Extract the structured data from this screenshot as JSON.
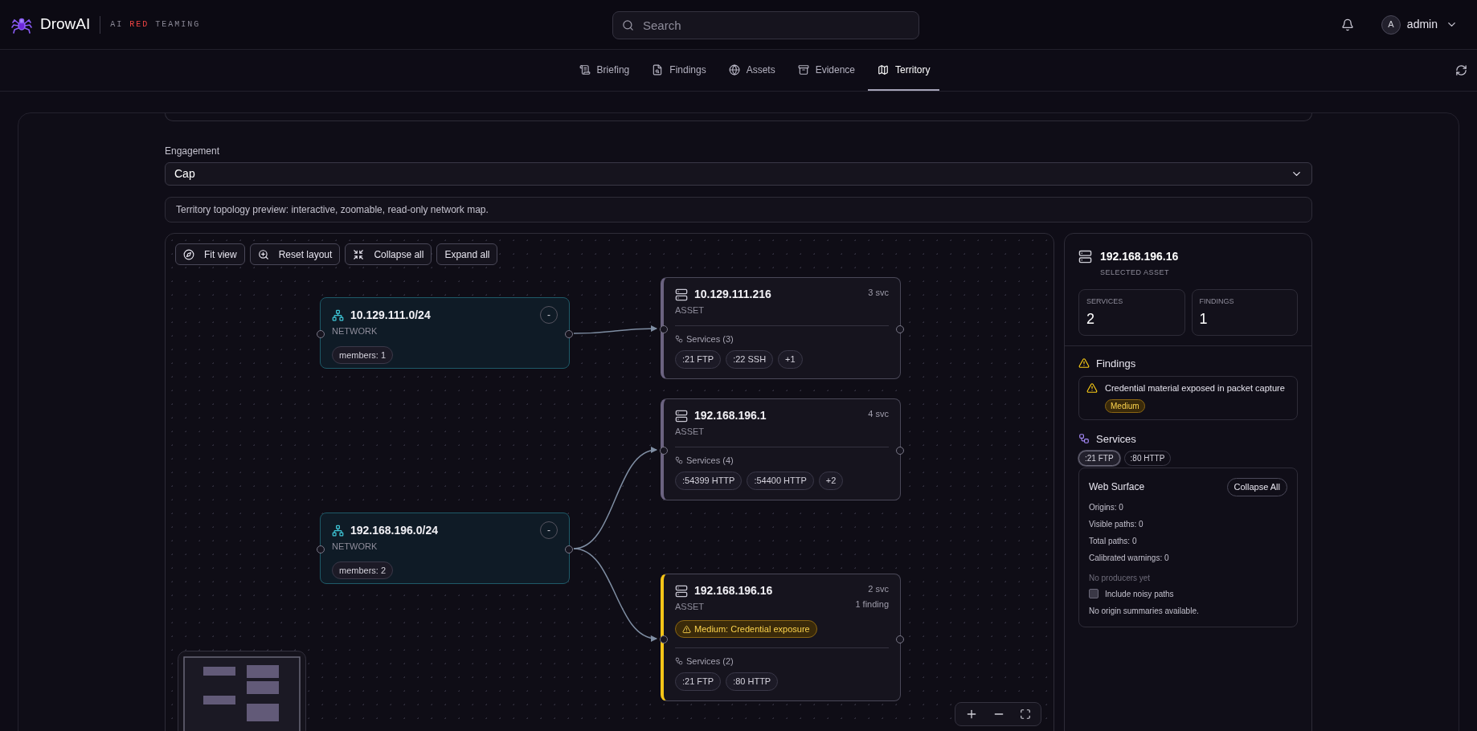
{
  "header": {
    "brand": "DrowAI",
    "tagline": [
      {
        "text": "AI",
        "accent": false
      },
      {
        "text": "RED",
        "accent": true
      },
      {
        "text": "TEAMING",
        "accent": false
      }
    ],
    "search": {
      "placeholder": "Search"
    },
    "user": {
      "initial": "A",
      "name": "admin"
    }
  },
  "tabs": [
    {
      "label": "Briefing",
      "selected": false
    },
    {
      "label": "Findings",
      "selected": false
    },
    {
      "label": "Assets",
      "selected": false
    },
    {
      "label": "Evidence",
      "selected": false
    },
    {
      "label": "Territory",
      "selected": true
    }
  ],
  "engagement": {
    "label": "Engagement",
    "value": "Cap"
  },
  "description": "Territory topology preview: interactive, zoomable, read-only network map.",
  "toolbar": [
    "Fit view",
    "Reset layout",
    "Collapse all",
    "Expand all"
  ],
  "nodes": [
    {
      "kind": "network",
      "title": "10.129.111.0/24",
      "subtitle": "NETWORK",
      "members": "members: 1",
      "toggle": "-"
    },
    {
      "kind": "asset",
      "title": "10.129.111.216",
      "subtitle": "ASSET",
      "count": "3 svc",
      "services_label": "Services (3)",
      "services": [
        ":21 FTP",
        ":22 SSH",
        "+1"
      ],
      "selected": false
    },
    {
      "kind": "asset",
      "title": "192.168.196.1",
      "subtitle": "ASSET",
      "count": "4 svc",
      "services_label": "Services (4)",
      "services": [
        ":54399 HTTP",
        ":54400 HTTP",
        "+2"
      ],
      "selected": false
    },
    {
      "kind": "network",
      "title": "192.168.196.0/24",
      "subtitle": "NETWORK",
      "members": "members: 2",
      "toggle": "-"
    },
    {
      "kind": "asset",
      "title": "192.168.196.16",
      "subtitle": "ASSET",
      "count": "2 svc",
      "findings": "1 finding",
      "alert": "Medium: Credential exposure",
      "services_label": "Services (2)",
      "services": [
        ":21 FTP",
        ":80 HTTP"
      ],
      "selected": true
    }
  ],
  "detail": {
    "title": "192.168.196.16",
    "subtitle": "SELECTED ASSET",
    "stats": [
      {
        "label": "SERVICES",
        "value": "2"
      },
      {
        "label": "FINDINGS",
        "value": "1"
      }
    ],
    "findings": {
      "heading": "Findings",
      "items": [
        {
          "text": "Credential material exposed in packet capture",
          "severity": "Medium"
        }
      ]
    },
    "services": {
      "heading": "Services",
      "chips": [
        {
          "label": ":21 FTP",
          "selected": true
        },
        {
          "label": ":80 HTTP",
          "selected": false
        }
      ]
    },
    "web_surface": {
      "title": "Web Surface",
      "button": "Collapse All",
      "lines": [
        "Origins: 0",
        "Visible paths: 0",
        "Total paths: 0",
        "Calibrated warnings: 0"
      ],
      "note": "No producers yet",
      "checkbox": {
        "label": "Include noisy paths",
        "checked": false
      },
      "empty": "No origin summaries available."
    }
  }
}
